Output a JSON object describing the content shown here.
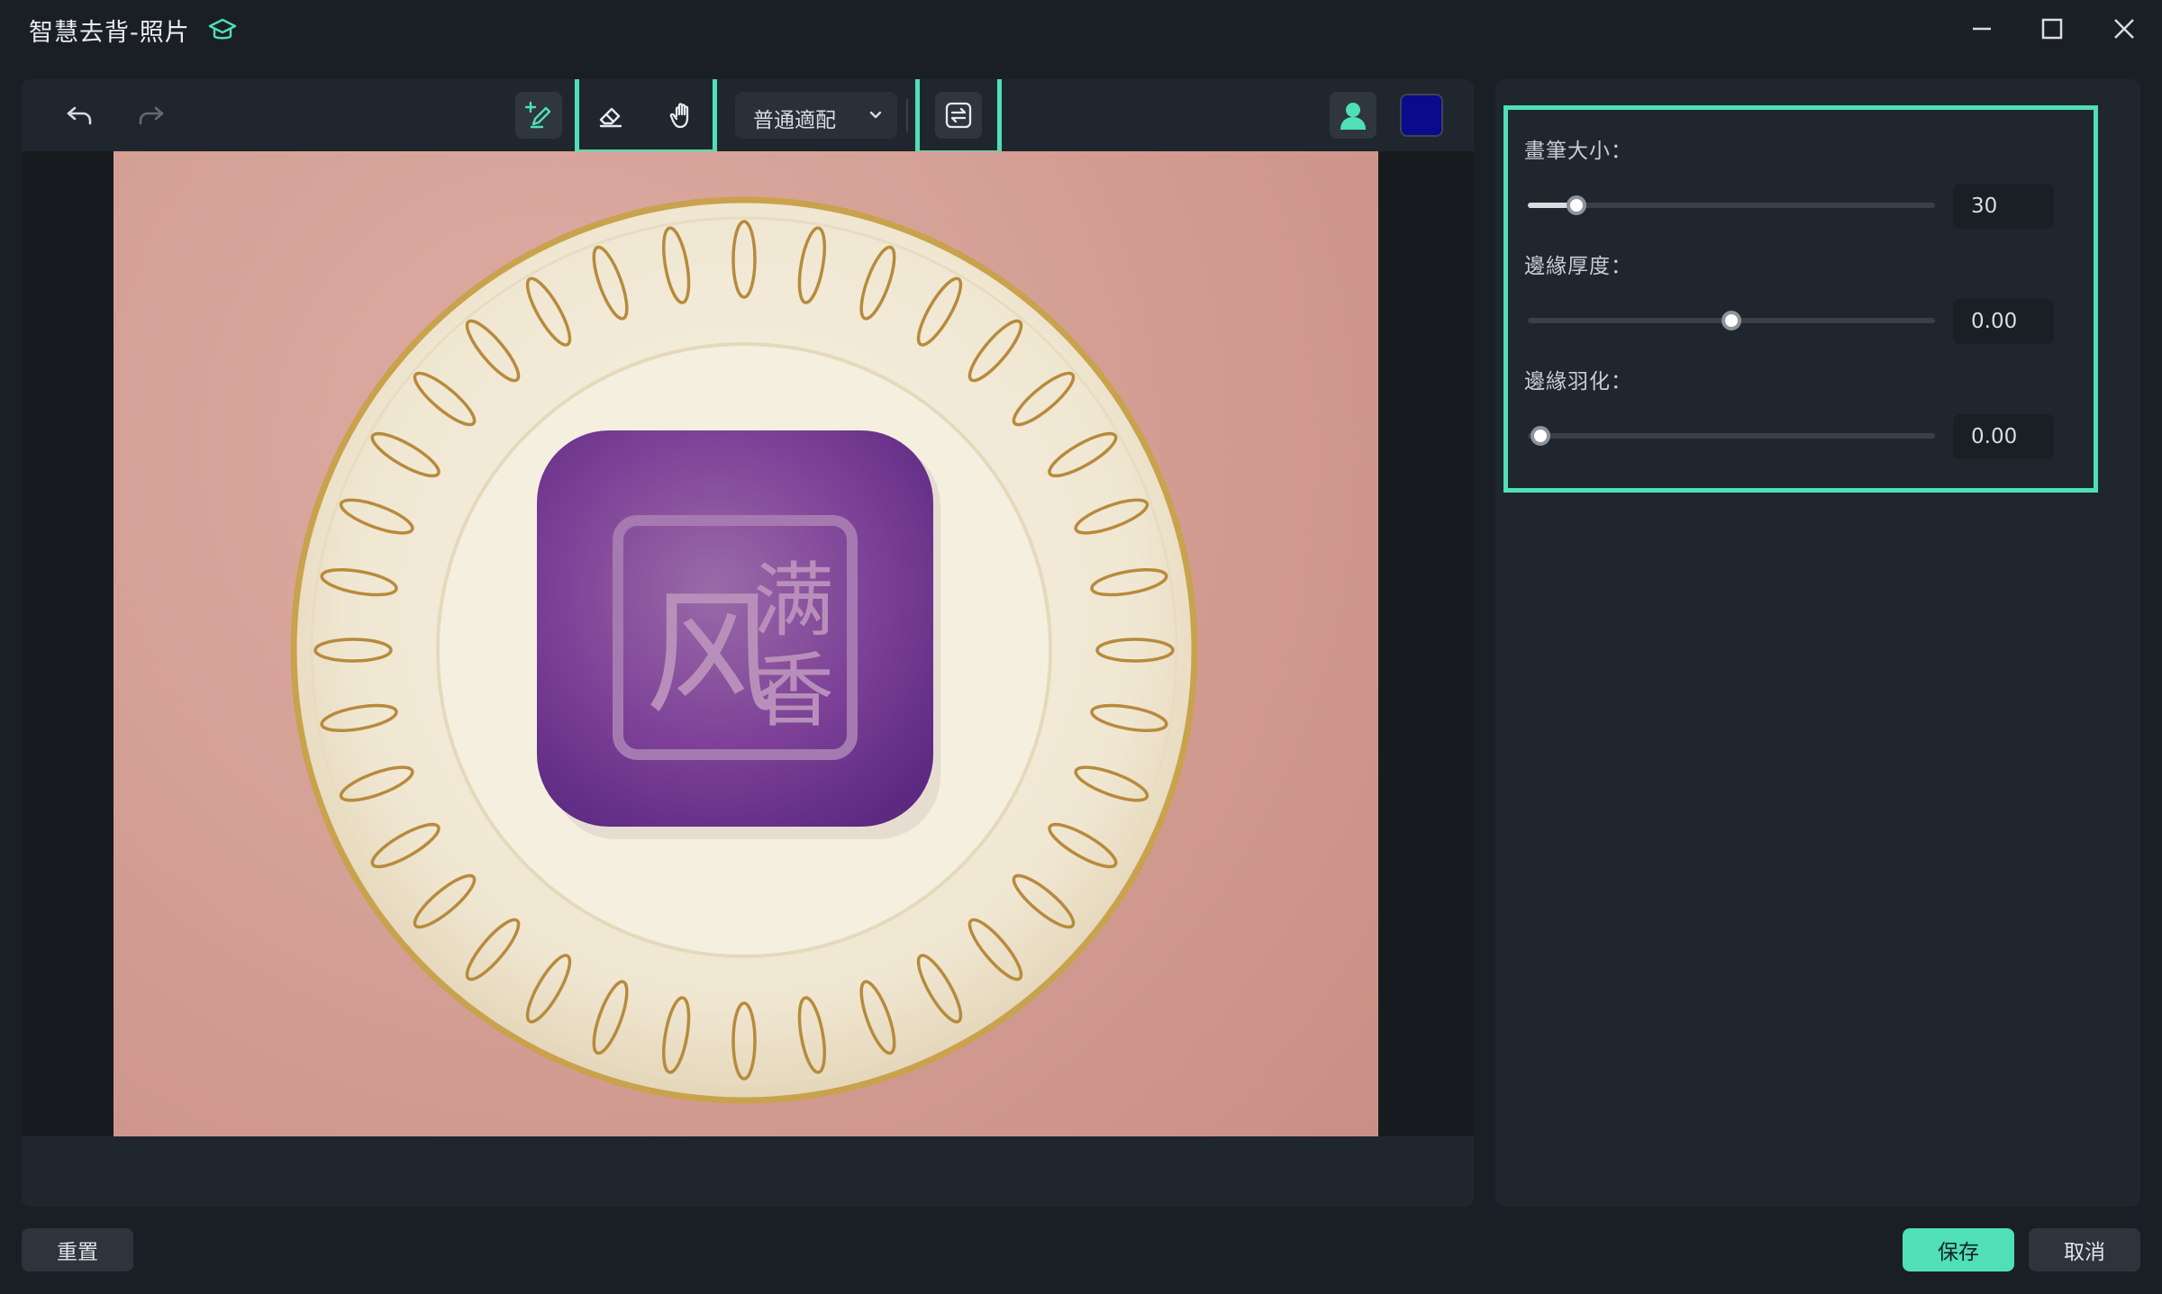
{
  "window": {
    "title": "智慧去背-照片",
    "title_icon": "graduation-cap-icon",
    "controls": [
      "minimize-icon",
      "maximize-icon",
      "close-icon"
    ]
  },
  "toolbar": {
    "undo_icon": "undo-icon",
    "redo_icon": "redo-icon",
    "brush_icon": "add-brush-icon",
    "eraser_icon": "eraser-icon",
    "hand_icon": "hand-icon",
    "fit_mode": "普通適配",
    "swap_icon": "swap-icon",
    "person_icon": "person-icon",
    "background_color": "#0a0a8c"
  },
  "settings": {
    "brush_size": {
      "label": "畫筆大小：",
      "value": "30",
      "fraction": 0.12
    },
    "edge_thickness": {
      "label": "邊緣厚度：",
      "value": "0.00",
      "fraction": 0.5
    },
    "edge_feather": {
      "label": "邊緣羽化：",
      "value": "0.00",
      "fraction": 0.03
    }
  },
  "footer": {
    "reset_label": "重置",
    "save_label": "保存",
    "cancel_label": "取消"
  },
  "colors": {
    "accent": "#4fe0b5",
    "background": "#1a1f25",
    "panel": "#20262d"
  },
  "photo": {
    "text_left": "风",
    "text_right_top": "满",
    "text_right_bottom": "香"
  }
}
